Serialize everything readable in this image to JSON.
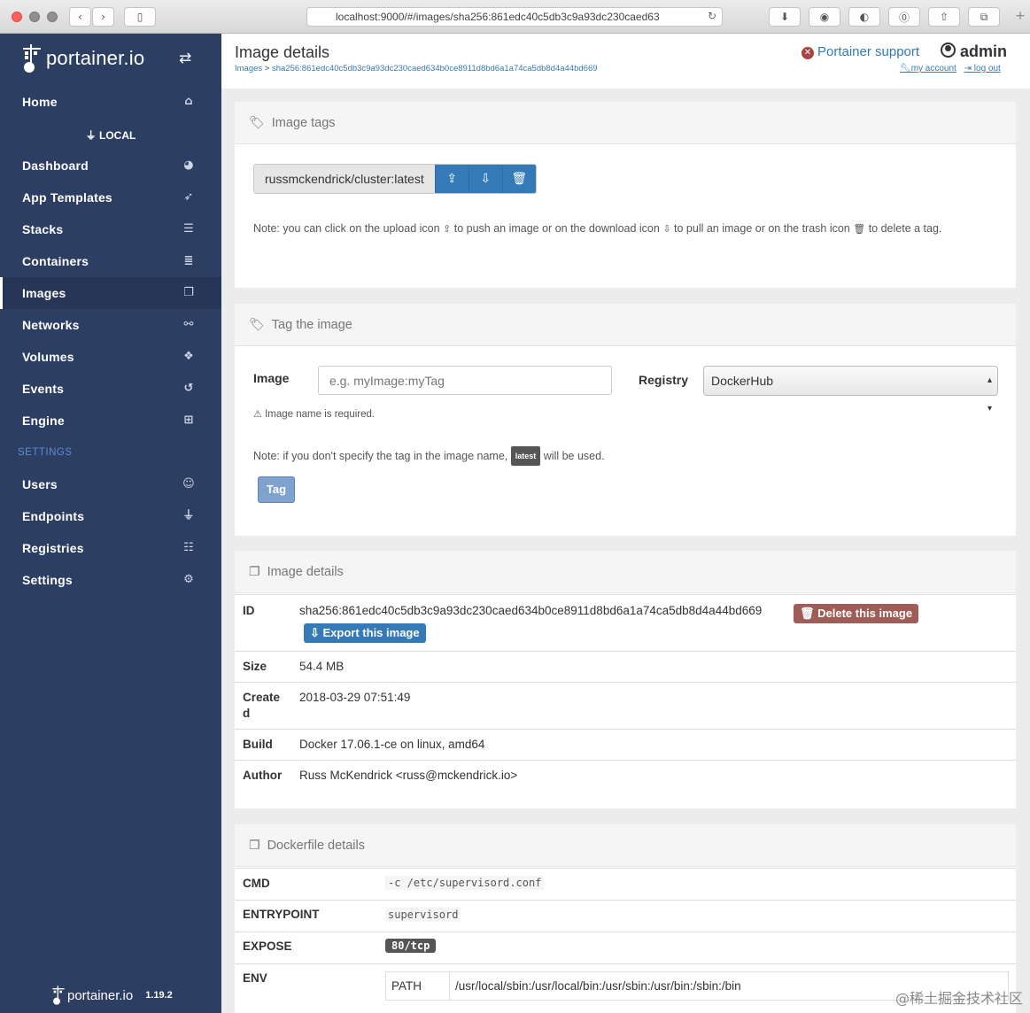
{
  "browser": {
    "url": "localhost:9000/#/images/sha256:861edc40c5db3c9a93dc230caed63",
    "back_icon": "chevron-left-icon",
    "forward_icon": "chevron-right-icon"
  },
  "sidebar": {
    "brand": "portainer.io",
    "endpoint": "LOCAL",
    "items": [
      {
        "label": "Home",
        "icon": "home-icon",
        "glyph": "⌂"
      },
      {
        "label": "Dashboard",
        "icon": "tachometer-icon",
        "glyph": "◕"
      },
      {
        "label": "App Templates",
        "icon": "rocket-icon",
        "glyph": "➶"
      },
      {
        "label": "Stacks",
        "icon": "th-list-icon",
        "glyph": "☰"
      },
      {
        "label": "Containers",
        "icon": "server-icon",
        "glyph": "≣"
      },
      {
        "label": "Images",
        "icon": "clone-icon",
        "glyph": "❐"
      },
      {
        "label": "Networks",
        "icon": "sitemap-icon",
        "glyph": "⚯"
      },
      {
        "label": "Volumes",
        "icon": "cubes-icon",
        "glyph": "❖"
      },
      {
        "label": "Events",
        "icon": "history-icon",
        "glyph": "↺"
      },
      {
        "label": "Engine",
        "icon": "th-icon",
        "glyph": "⊞"
      }
    ],
    "settings_heading": "SETTINGS",
    "settings_items": [
      {
        "label": "Users",
        "icon": "users-icon",
        "glyph": "☺"
      },
      {
        "label": "Endpoints",
        "icon": "plug-icon",
        "glyph": "⏚"
      },
      {
        "label": "Registries",
        "icon": "database-icon",
        "glyph": "☷"
      },
      {
        "label": "Settings",
        "icon": "cogs-icon",
        "glyph": "⚙"
      }
    ],
    "footer_brand": "portainer.io",
    "footer_version": "1.19.2"
  },
  "header": {
    "title": "Image details",
    "breadcrumb_root": "Images",
    "breadcrumb_sep": ">",
    "breadcrumb_current": "sha256:861edc40c5db3c9a93dc230caed634b0ce8911d8bd6a1a74ca5db8d4a44bd669",
    "support_label": "Portainer support",
    "username": "admin",
    "my_account": "my account",
    "log_out": "log out"
  },
  "image_tags": {
    "heading": "Image tags",
    "tag": "russmckendrick/cluster:latest",
    "note_parts": [
      "Note: you can click on the upload icon",
      "to push an image or on the download icon",
      "to pull an image or on the trash icon",
      "to delete a tag."
    ]
  },
  "tag_image": {
    "heading": "Tag the image",
    "image_label": "Image",
    "image_placeholder": "e.g. myImage:myTag",
    "registry_label": "Registry",
    "registry_value": "DockerHub",
    "warning": "Image name is required.",
    "note_before": "Note: if you don't specify the tag in the image name,",
    "note_badge": "latest",
    "note_after": "will be used.",
    "submit_label": "Tag"
  },
  "image_details": {
    "heading": "Image details",
    "id_label": "ID",
    "id_value": "sha256:861edc40c5db3c9a93dc230caed634b0ce8911d8bd6a1a74ca5db8d4a44bd669",
    "delete_label": "Delete this image",
    "export_label": "Export this image",
    "size_label": "Size",
    "size_value": "54.4 MB",
    "created_label_1": "Create",
    "created_label_2": "d",
    "created_value": "2018-03-29 07:51:49",
    "build_label": "Build",
    "build_value": "Docker 17.06.1-ce on linux, amd64",
    "author_label": "Author",
    "author_value": "Russ McKendrick <russ@mckendrick.io>"
  },
  "dockerfile": {
    "heading": "Dockerfile details",
    "cmd_label": "CMD",
    "cmd_value": "-c /etc/supervisord.conf",
    "entrypoint_label": "ENTRYPOINT",
    "entrypoint_value": "supervisord",
    "expose_label": "EXPOSE",
    "expose_value": "80/tcp",
    "env_label": "ENV",
    "env_key": "PATH",
    "env_value": "/usr/local/sbin:/usr/local/bin:/usr/sbin:/usr/bin:/sbin:/bin"
  },
  "watermark": "@稀土掘金技术社区"
}
